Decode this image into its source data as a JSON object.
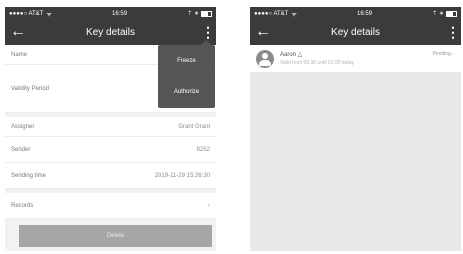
{
  "left": {
    "status": {
      "carrier": "●●●●○ AT&T",
      "wifi": "ᯤ",
      "time": "16:59",
      "right": "⇡ ∗"
    },
    "nav": {
      "back": "←",
      "title": "Key details",
      "more": "⋮"
    },
    "rows": [
      {
        "label": "Name",
        "value": ""
      },
      {
        "label": "Validity Period",
        "value_lines": [
          "2019",
          "2019"
        ]
      },
      {
        "label": "Assigner",
        "value": "Grant Grant"
      },
      {
        "label": "Sender",
        "value": "8252"
      },
      {
        "label": "Sending time",
        "value": "2019-11-29 15:26:30"
      },
      {
        "label": "Records",
        "value": "›"
      }
    ],
    "popup": {
      "items": [
        "Freeze",
        "Authorize"
      ]
    },
    "delete_label": "Delete"
  },
  "right": {
    "status": {
      "carrier": "●●●●○ AT&T",
      "wifi": "ᯤ",
      "time": "16:59",
      "right": "⇡ ∗"
    },
    "nav": {
      "back": "←",
      "title": "Key details",
      "more": "⋮"
    },
    "record": {
      "name": "Aaron △",
      "subtitle": "Valid from 09:30 until 01:00 today",
      "status": "Pending..."
    }
  }
}
